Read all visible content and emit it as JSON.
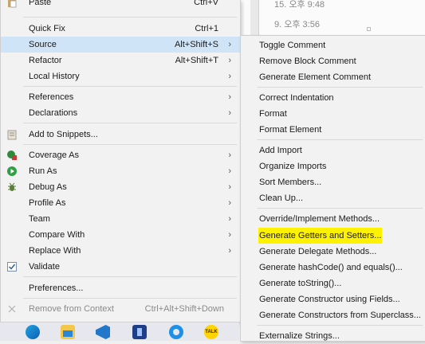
{
  "background": {
    "line1": "15. 오후 9:48",
    "line2": "9. 오후 3:56"
  },
  "main_menu": {
    "paste": {
      "label": "Paste",
      "shortcut": "Ctrl+V"
    },
    "quick_fix": {
      "label": "Quick Fix",
      "shortcut": "Ctrl+1"
    },
    "source": {
      "label": "Source",
      "shortcut": "Alt+Shift+S"
    },
    "refactor": {
      "label": "Refactor",
      "shortcut": "Alt+Shift+T"
    },
    "local_history": {
      "label": "Local History"
    },
    "references": {
      "label": "References"
    },
    "declarations": {
      "label": "Declarations"
    },
    "add_to_snippets": {
      "label": "Add to Snippets..."
    },
    "coverage_as": {
      "label": "Coverage As"
    },
    "run_as": {
      "label": "Run As"
    },
    "debug_as": {
      "label": "Debug As"
    },
    "profile_as": {
      "label": "Profile As"
    },
    "team": {
      "label": "Team"
    },
    "compare_with": {
      "label": "Compare With"
    },
    "replace_with": {
      "label": "Replace With"
    },
    "validate": {
      "label": "Validate"
    },
    "preferences": {
      "label": "Preferences..."
    },
    "remove_from_context": {
      "label": "Remove from Context",
      "shortcut": "Ctrl+Alt+Shift+Down"
    },
    "arrow": "›"
  },
  "source_submenu": {
    "toggle_comment": "Toggle Comment",
    "remove_block_comment": "Remove Block Comment",
    "generate_element_comment": "Generate Element Comment",
    "correct_indentation": "Correct Indentation",
    "format": "Format",
    "format_element": "Format Element",
    "add_import": "Add Import",
    "organize_imports": "Organize Imports",
    "sort_members": "Sort Members...",
    "clean_up": "Clean Up...",
    "override_implement": "Override/Implement Methods...",
    "generate_getters_setters": "Generate Getters and Setters...",
    "generate_delegate": "Generate Delegate Methods...",
    "generate_hashcode_equals": "Generate hashCode() and equals()...",
    "generate_tostring": "Generate toString()...",
    "generate_constructor_fields": "Generate Constructor using Fields...",
    "generate_constructors_superclass": "Generate Constructors from Superclass...",
    "externalize_strings": "Externalize Strings..."
  },
  "taskbar": {
    "talk_label": "TALK"
  },
  "colors": {
    "selected": "#cfe4f7",
    "highlight": "#fff200"
  }
}
